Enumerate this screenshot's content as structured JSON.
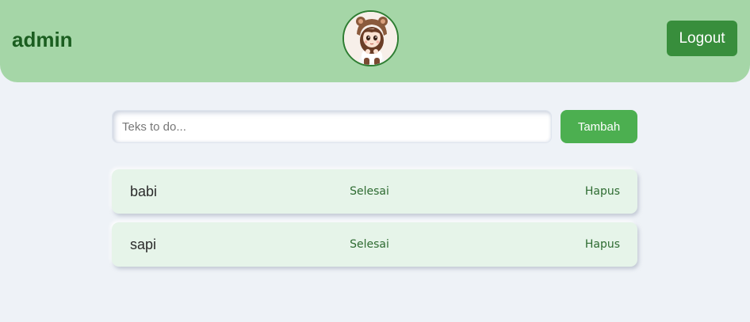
{
  "header": {
    "username": "admin",
    "avatar_icon": "avatar-chibi-girl-bear-hood",
    "logout_label": "Logout",
    "background_color": "#a5d6a7",
    "username_color": "#1b5e20",
    "logout_color": "#388e3c"
  },
  "form": {
    "placeholder": "Teks to do...",
    "value": "",
    "add_label": "Tambah",
    "add_color": "#4caf50"
  },
  "todos": [
    {
      "text": "babi",
      "done_label": "Selesai",
      "delete_label": "Hapus"
    },
    {
      "text": "sapi",
      "done_label": "Selesai",
      "delete_label": "Hapus"
    }
  ],
  "colors": {
    "page_background": "#eef2f7",
    "todo_background": "#e6f4e9"
  }
}
